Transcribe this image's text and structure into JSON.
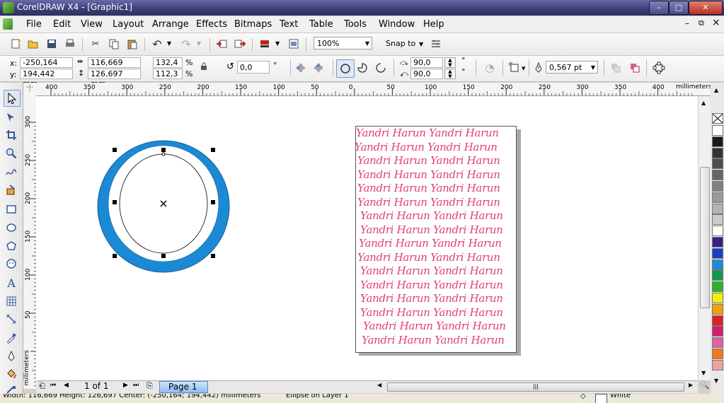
{
  "window": {
    "title": "CorelDRAW X4 - [Graphic1]",
    "buttons": {
      "minimize": "–",
      "maximize": "□",
      "close": "✕"
    }
  },
  "menu": {
    "items": [
      {
        "label": "File"
      },
      {
        "label": "Edit"
      },
      {
        "label": "View"
      },
      {
        "label": "Layout"
      },
      {
        "label": "Arrange"
      },
      {
        "label": "Effects"
      },
      {
        "label": "Bitmaps"
      },
      {
        "label": "Text"
      },
      {
        "label": "Table"
      },
      {
        "label": "Tools"
      },
      {
        "label": "Window"
      },
      {
        "label": "Help"
      }
    ],
    "doc_controls": {
      "minimize": "–",
      "restore": "⧉",
      "close": "×"
    }
  },
  "standard_toolbar": {
    "zoom_value": "100%",
    "snap_label": "Snap to",
    "icons": [
      "new-icon",
      "open-icon",
      "save-icon",
      "print-icon",
      "cut-icon",
      "copy-icon",
      "paste-icon",
      "undo-icon",
      "redo-icon",
      "import-icon",
      "export-icon",
      "launcher-icon",
      "welcome-icon",
      "options-icon"
    ]
  },
  "property_bar": {
    "x_label": "x:",
    "x_value": "-250,164 mm",
    "y_label": "y:",
    "y_value": "194,442 mm",
    "width_value": "116,669 mm",
    "height_value": "126,697 mm",
    "scale_x": "132,4",
    "scale_y": "112,3",
    "percent": "%",
    "rotation": "0,0",
    "degree": "°",
    "start_angle": "90,0",
    "end_angle": "90,0",
    "outline_width": "0,567 pt"
  },
  "rulers": {
    "horizontal_ticks": [
      "400",
      "350",
      "300",
      "250",
      "200",
      "150",
      "100",
      "50",
      "0",
      "50",
      "100",
      "150",
      "200",
      "250",
      "300",
      "350",
      "400"
    ],
    "units": "millimeters",
    "vertical_ticks": [
      "300",
      "250",
      "200",
      "150",
      "100",
      "50",
      "0"
    ],
    "vertical_units": "millimeters"
  },
  "page_text": {
    "lines": [
      "Yandri Harun Yandri Harun",
      "Yandri Harun Yandri Harun",
      "Yandri Harun Yandri Harun",
      "Yandri Harun Yandri Harun",
      "Yandri Harun Yandri Harun",
      "Yandri Harun Yandri Harun",
      "Yandri Harun Yandri Harun",
      "Yandri Harun Yandri Harun",
      "Yandri Harun Yandri Harun",
      "Yandri Harun Yandri Harun",
      "Yandri Harun Yandri Harun",
      "Yandri Harun Yandri Harun",
      "Yandri Harun Yandri Harun",
      "Yandri Harun Yandri Harun",
      "Yandri Harun Yandri Harun",
      "Yandri Harun Yandri Harun"
    ],
    "color": "#e0407a"
  },
  "ellipse": {
    "ring_color": "#1a8ad6"
  },
  "page_nav": {
    "page_count": "1 of 1",
    "tab_label": "Page 1"
  },
  "palette": {
    "colors": [
      "#ffffff",
      "#1a1a1a",
      "#333333",
      "#4d4d4d",
      "#666666",
      "#808080",
      "#999999",
      "#b3b3b3",
      "#cccccc",
      "#ffffff",
      "#3a1f8a",
      "#1a3fc4",
      "#1f8ad6",
      "#0f9a4a",
      "#2ab22a",
      "#f2f200",
      "#f2a000",
      "#e01f1f",
      "#d41f6a",
      "#e060a0",
      "#f07a1a",
      "#f0a0a0"
    ]
  },
  "status": {
    "dimensions_text": "Width: 116,669  Height: 126,697  Center: (-250,164; 194,442)  millimeters",
    "object_text": "Ellipse on Layer 1",
    "fill_label": "White"
  }
}
